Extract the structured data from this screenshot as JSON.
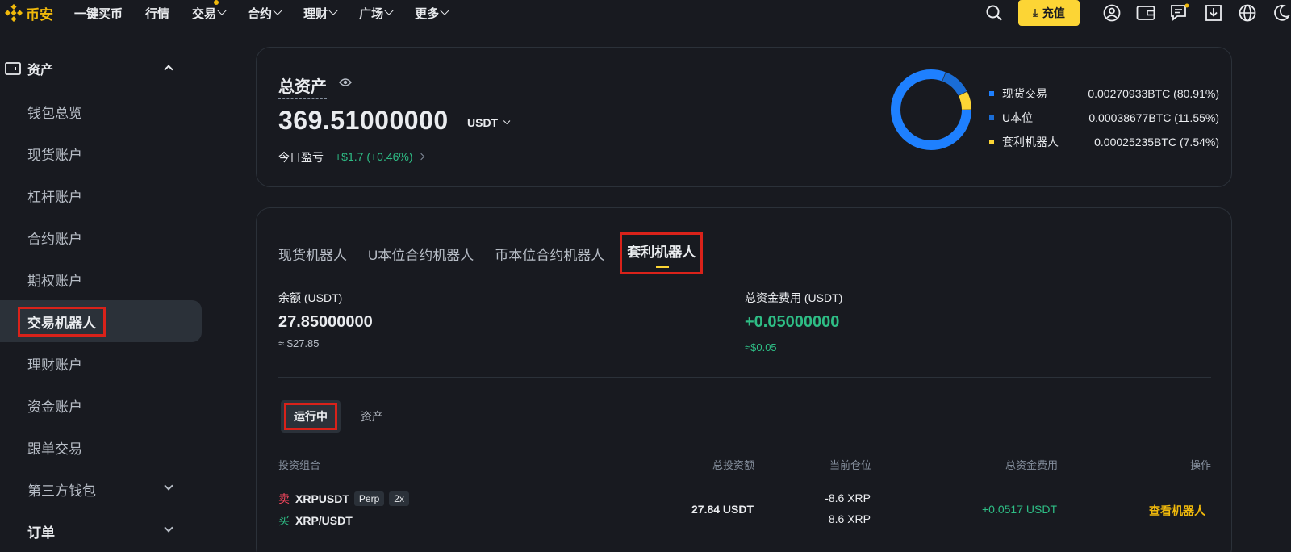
{
  "brand": {
    "name": "币安",
    "color": "#f0b90b"
  },
  "nav": {
    "items": [
      {
        "label": "一键买币",
        "has_menu": false
      },
      {
        "label": "行情",
        "has_menu": false
      },
      {
        "label": "交易",
        "has_menu": true,
        "dot": true
      },
      {
        "label": "合约",
        "has_menu": true
      },
      {
        "label": "理财",
        "has_menu": true
      },
      {
        "label": "广场",
        "has_menu": true
      },
      {
        "label": "更多",
        "has_menu": true
      }
    ],
    "deposit_label": "充值",
    "right_icons": [
      "search-icon",
      "user-icon",
      "wallet-icon",
      "message-icon",
      "download-icon",
      "globe-icon",
      "moon-icon"
    ]
  },
  "sidebar": {
    "section_label": "资产",
    "items": [
      {
        "label": "钱包总览"
      },
      {
        "label": "现货账户"
      },
      {
        "label": "杠杆账户"
      },
      {
        "label": "合约账户"
      },
      {
        "label": "期权账户"
      },
      {
        "label": "交易机器人",
        "active": true
      },
      {
        "label": "理财账户"
      },
      {
        "label": "资金账户"
      },
      {
        "label": "跟单交易"
      },
      {
        "label": "第三方钱包",
        "has_menu": true
      },
      {
        "label": "订单",
        "has_menu": true
      }
    ]
  },
  "overview": {
    "title": "总资产",
    "value": "369.51000000",
    "unit": "USDT",
    "pnl_label": "今日盈亏",
    "pnl_value": "+$1.7 (+0.46%)",
    "allocation": [
      {
        "label": "现货交易",
        "value": "0.00270933BTC (80.91%)",
        "percent": 80.91,
        "color": "#1e80ff"
      },
      {
        "label": "U本位",
        "value": "0.00038677BTC (11.55%)",
        "percent": 11.55,
        "color": "#1a6dd6"
      },
      {
        "label": "套利机器人",
        "value": "0.00025235BTC (7.54%)",
        "percent": 7.54,
        "color": "#fcd535"
      }
    ]
  },
  "bots": {
    "tabs": [
      {
        "label": "现货机器人"
      },
      {
        "label": "U本位合约机器人"
      },
      {
        "label": "币本位合约机器人"
      },
      {
        "label": "套利机器人",
        "active": true
      }
    ],
    "balance_label": "余额 (USDT)",
    "balance_value": "27.85000000",
    "balance_sub": "≈ $27.85",
    "fee_label": "总资金费用 (USDT)",
    "fee_value": "+0.05000000",
    "fee_sub": "≈$0.05",
    "subtabs": {
      "running": "运行中",
      "assets": "资产"
    },
    "table": {
      "headers": [
        "投资组合",
        "总投资额",
        "当前仓位",
        "总资金费用",
        "操作"
      ],
      "rows": [
        {
          "sell_tag": "卖",
          "sell_pair": "XRPUSDT",
          "perp_tag": "Perp",
          "leverage": "2x",
          "buy_tag": "买",
          "buy_pair": "XRP/USDT",
          "total_investment": "27.84 USDT",
          "position_1": "-8.6 XRP",
          "position_2": "8.6 XRP",
          "funding_fee": "+0.0517 USDT",
          "action": "查看机器人"
        }
      ]
    }
  }
}
